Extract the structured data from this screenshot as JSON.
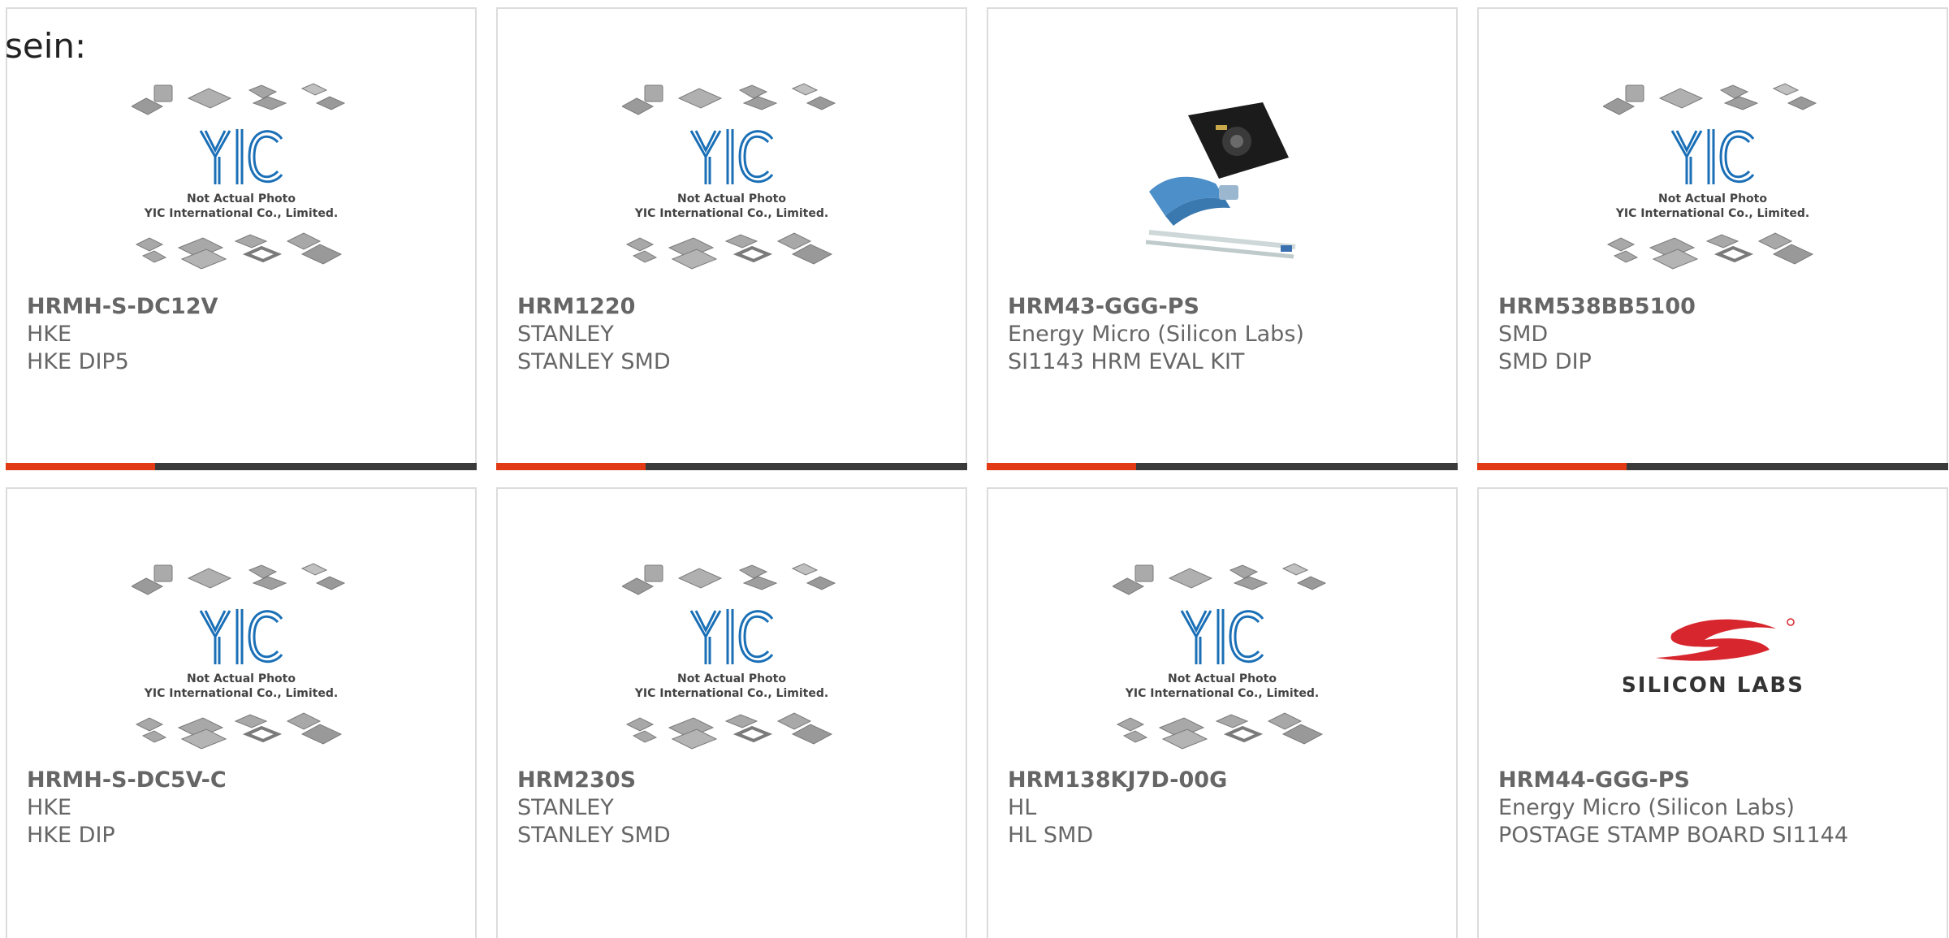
{
  "lead_text": "sein:",
  "placeholder": {
    "logo_text": "YIC",
    "line1": "Not Actual Photo",
    "line2": "YIC International Co., Limited."
  },
  "brand_logo_text": "SILICON LABS",
  "colors": {
    "accent": "#e23a14",
    "bar": "#3a3a3a",
    "text": "#666666",
    "yic_blue": "#1a6fb6",
    "silicon_red": "#d7262e"
  },
  "products": [
    {
      "part": "HRMH-S-DC12V",
      "maker": "HKE",
      "desc": "HKE DIP5",
      "image": "yic-placeholder"
    },
    {
      "part": "HRM1220",
      "maker": "STANLEY",
      "desc": "STANLEY SMD",
      "image": "yic-placeholder"
    },
    {
      "part": "HRM43-GGG-PS",
      "maker": "Energy Micro (Silicon Labs)",
      "desc": "SI1143 HRM EVAL KIT",
      "image": "eval-kit-photo"
    },
    {
      "part": "HRM538BB5100",
      "maker": "SMD",
      "desc": "SMD DIP",
      "image": "yic-placeholder"
    },
    {
      "part": "HRMH-S-DC5V-C",
      "maker": "HKE",
      "desc": "HKE DIP",
      "image": "yic-placeholder"
    },
    {
      "part": "HRM230S",
      "maker": "STANLEY",
      "desc": "STANLEY SMD",
      "image": "yic-placeholder"
    },
    {
      "part": "HRM138KJ7D-00G",
      "maker": "HL",
      "desc": "HL SMD",
      "image": "yic-placeholder"
    },
    {
      "part": "HRM44-GGG-PS",
      "maker": "Energy Micro (Silicon Labs)",
      "desc": "POSTAGE STAMP BOARD SI1144",
      "image": "silicon-labs-logo"
    }
  ]
}
